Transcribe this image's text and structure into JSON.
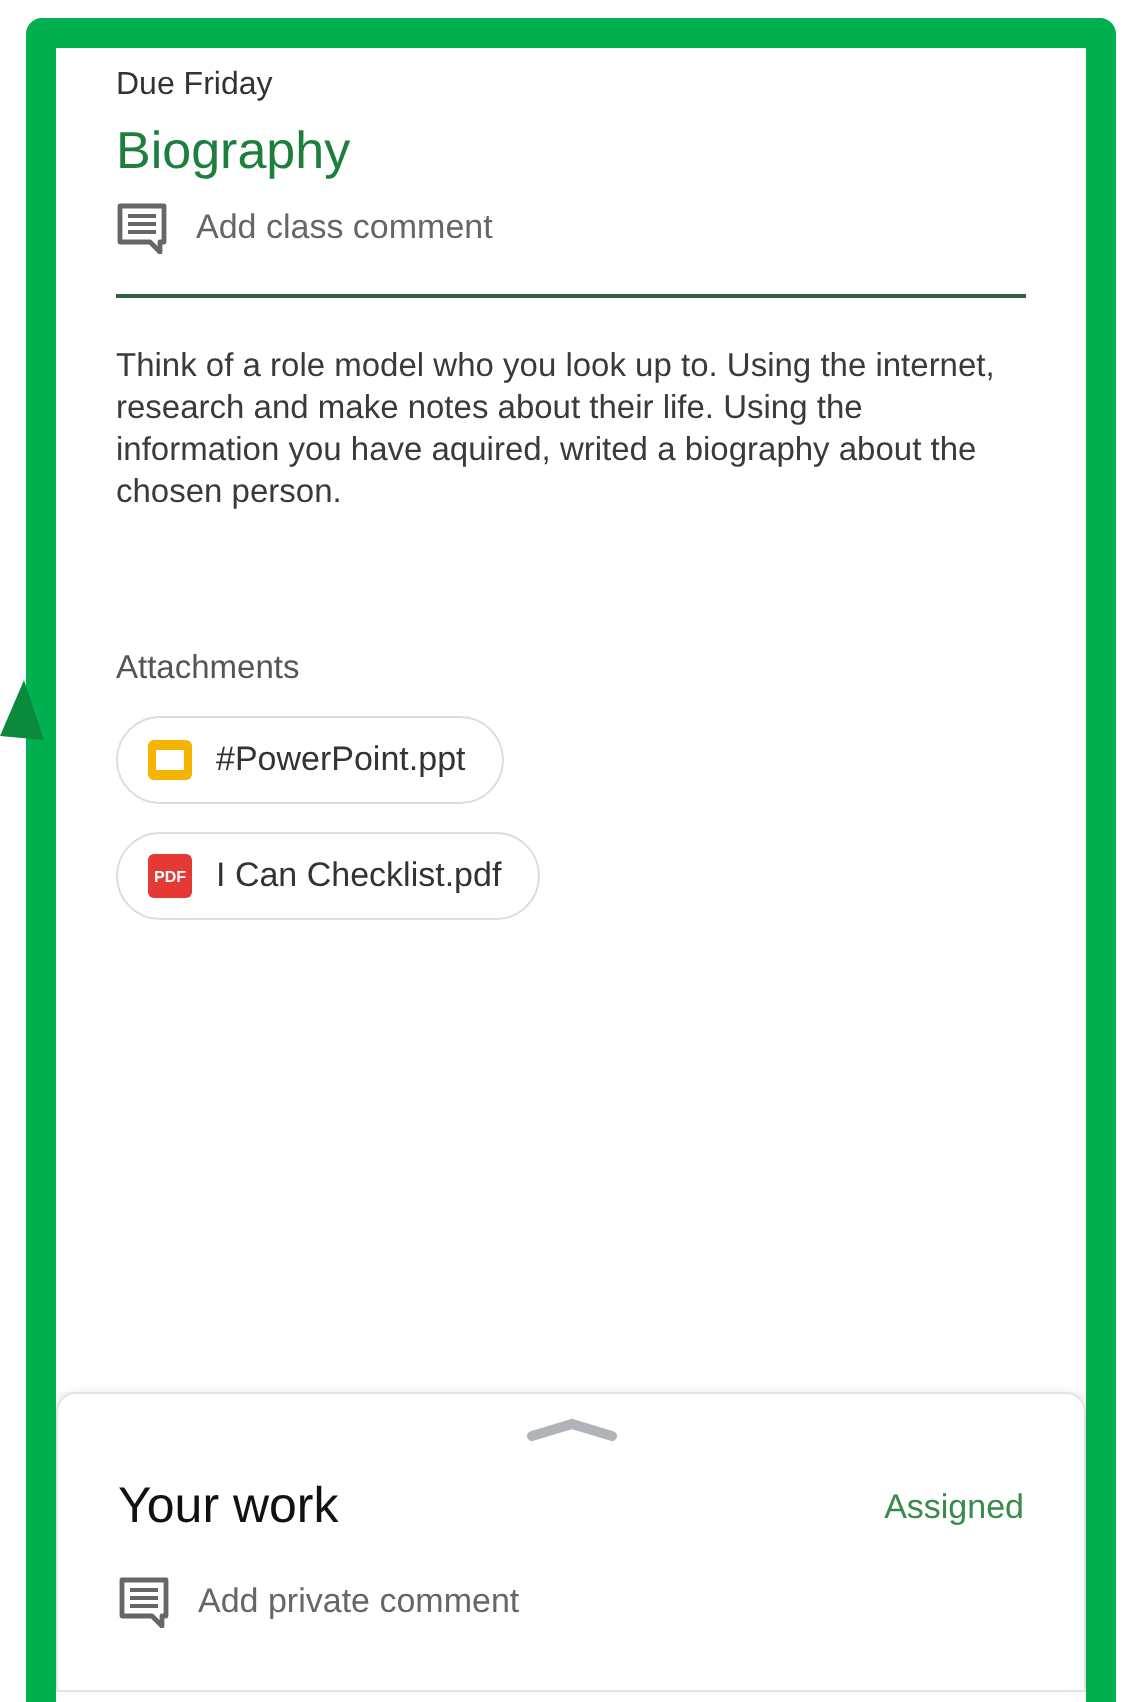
{
  "assignment": {
    "due": "Due Friday",
    "title": "Biography",
    "class_comment": "Add class comment",
    "instructions": "Think of a role model who you look up to. Using the internet, research and make notes about their life. Using the information you have aquired, writed a biography about the chosen person."
  },
  "attachments_label": "Attachments",
  "attachments": [
    {
      "kind": "slides",
      "name": "#PowerPoint.ppt"
    },
    {
      "kind": "pdf",
      "name": "I Can Checklist.pdf",
      "icon_text": "PDF"
    }
  ],
  "your_work": {
    "title": "Your work",
    "status": "Assigned",
    "private_comment": "Add private comment"
  }
}
